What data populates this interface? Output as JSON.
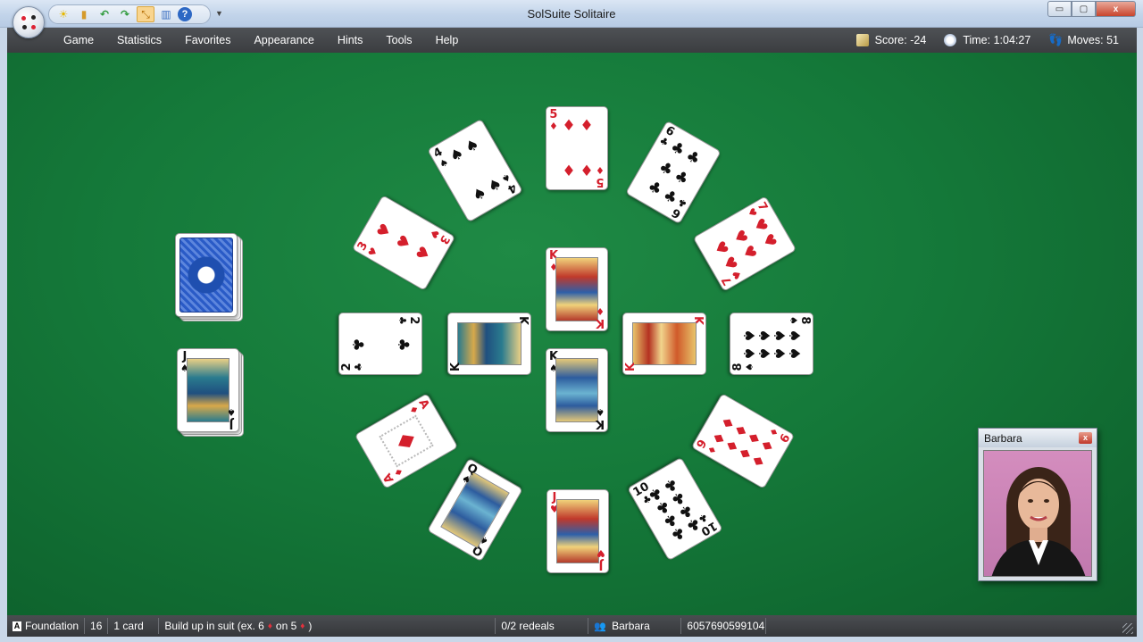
{
  "window": {
    "title": "SolSuite Solitaire",
    "controls": {
      "minimize": "▭",
      "maximize": "▢",
      "close": "x"
    }
  },
  "quick_access": [
    {
      "icon": "sun-new-game-icon",
      "glyph": "☀"
    },
    {
      "icon": "card-deal-icon",
      "glyph": "▮"
    },
    {
      "icon": "undo-arrow-icon",
      "glyph": "↶"
    },
    {
      "icon": "redo-arrow-icon",
      "glyph": "↷"
    },
    {
      "icon": "hint-arrows-icon",
      "glyph": "⤡",
      "active": true
    },
    {
      "icon": "statistics-chart-icon",
      "glyph": "▥"
    },
    {
      "icon": "help-question-icon",
      "glyph": "?"
    }
  ],
  "menu": [
    "Game",
    "Statistics",
    "Favorites",
    "Appearance",
    "Hints",
    "Tools",
    "Help"
  ],
  "stats": {
    "score_label": "Score:",
    "score_value": "-24",
    "time_label": "Time:",
    "time_value": "1:04:27",
    "moves_label": "Moves:",
    "moves_value": "51"
  },
  "cards": {
    "top_5": {
      "rank": "5",
      "suit": "♦"
    },
    "four_spades": {
      "rank": "4",
      "suit": "♠"
    },
    "six_clubs": {
      "rank": "6",
      "suit": "♣"
    },
    "three_hearts": {
      "rank": "3",
      "suit": "♥"
    },
    "seven_hearts": {
      "rank": "7",
      "suit": "♥"
    },
    "two_clubs": {
      "rank": "2",
      "suit": "♣"
    },
    "eight_spades": {
      "rank": "8",
      "suit": "♠"
    },
    "king_left": {
      "rank": "K",
      "suit": "♣"
    },
    "king_right": {
      "rank": "K",
      "suit": "♥"
    },
    "king_top": {
      "rank": "K",
      "suit": "♦"
    },
    "king_bottom": {
      "rank": "K",
      "suit": "♠"
    },
    "ace_diamonds": {
      "rank": "A",
      "suit": "♦"
    },
    "nine_diamonds": {
      "rank": "9",
      "suit": "♦"
    },
    "queen_spades": {
      "rank": "Q",
      "suit": "♠"
    },
    "ten_clubs": {
      "rank": "10",
      "suit": "♣"
    },
    "jack_hearts": {
      "rank": "J",
      "suit": "♥"
    },
    "waste_jack": {
      "rank": "J",
      "suit": "♠"
    }
  },
  "player": {
    "name": "Barbara",
    "close": "x"
  },
  "statusbar": {
    "pile_icon": "A",
    "pile": "Foundation",
    "count": "16",
    "cards": "1 card",
    "rule_prefix": "Build up in suit (ex. 6",
    "rule_on": "on 5",
    "rule_suffix": ")",
    "diamond": "♦",
    "redeals": "0/2 redeals",
    "player": "Barbara",
    "game_number": "6057690599104"
  },
  "colors": {
    "felt": "#157a3a",
    "red_suit": "#d41f2c",
    "card_back": "#2a5bc7"
  }
}
